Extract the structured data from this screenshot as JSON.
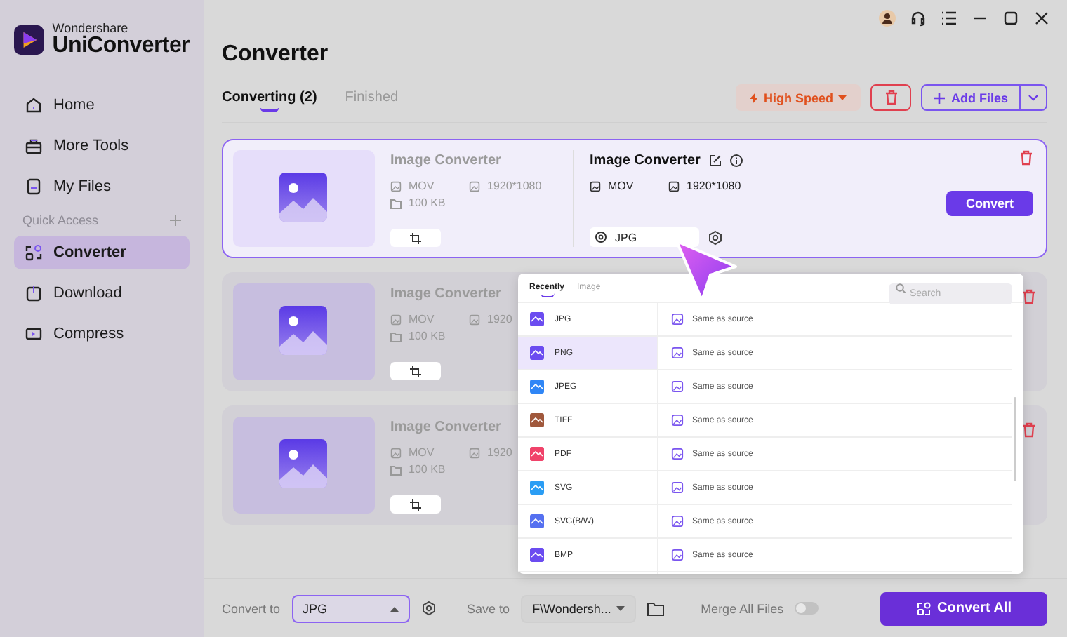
{
  "brand": {
    "company": "Wondershare",
    "product": "UniConverter"
  },
  "sidebar": {
    "items": [
      {
        "label": "Home",
        "selected": false
      },
      {
        "label": "More Tools",
        "selected": false
      },
      {
        "label": "My Files",
        "selected": false
      }
    ],
    "section": "Quick Access",
    "quick_items": [
      {
        "label": "Converter",
        "selected": true
      },
      {
        "label": "Download",
        "selected": false
      },
      {
        "label": "Compress",
        "selected": false
      }
    ]
  },
  "page_title": "Converter",
  "tabs": [
    {
      "label": "Converting (2)",
      "selected": true
    },
    {
      "label": "Finished",
      "selected": false
    }
  ],
  "toolbar": {
    "speed": "High Speed",
    "add": "Add Files"
  },
  "files": [
    {
      "active": true,
      "name": "Image Converter",
      "format": "MOV",
      "size": "100 KB",
      "resolution": "1920*1080",
      "output": {
        "name": "Image Converter",
        "format": "MOV",
        "resolution": "1920*1080",
        "target": "JPG"
      },
      "action": "Convert"
    },
    {
      "active": false,
      "name": "Image Converter",
      "format": "MOV",
      "size": "100 KB",
      "resolution": "1920"
    },
    {
      "active": false,
      "name": "Image Converter",
      "format": "MOV",
      "size": "100 KB",
      "resolution": "1920"
    }
  ],
  "format_menu": {
    "tabs": [
      {
        "label": "Recently",
        "selected": true
      },
      {
        "label": "Image",
        "selected": false
      }
    ],
    "search": {
      "placeholder": "Search"
    },
    "formats": [
      {
        "label": "JPG",
        "selected": false,
        "color": "#6b4cf0"
      },
      {
        "label": "PNG",
        "selected": true,
        "color": "#6b4cf0"
      },
      {
        "label": "JPEG",
        "selected": false,
        "color": "#2f86f6"
      },
      {
        "label": "TIFF",
        "selected": false,
        "color": "#a0583c"
      },
      {
        "label": "PDF",
        "selected": false,
        "color": "#f0436a"
      },
      {
        "label": "SVG",
        "selected": false,
        "color": "#2a9df4"
      },
      {
        "label": "SVG(B/W)",
        "selected": false,
        "color": "#5570f0"
      },
      {
        "label": "BMP",
        "selected": false,
        "color": "#6b4cf0"
      }
    ],
    "presets": [
      "Same as source",
      "Same as source",
      "Same as source",
      "Same as source",
      "Same as source",
      "Same as source",
      "Same as source",
      "Same as source"
    ]
  },
  "bottom": {
    "convert_to": {
      "label": "Convert to",
      "value": "JPG"
    },
    "save_to": {
      "label": "Save to",
      "value": "F\\Wondersh..."
    },
    "merge": {
      "label": "Merge All Files",
      "on": false
    },
    "convert_all": "Convert All"
  }
}
